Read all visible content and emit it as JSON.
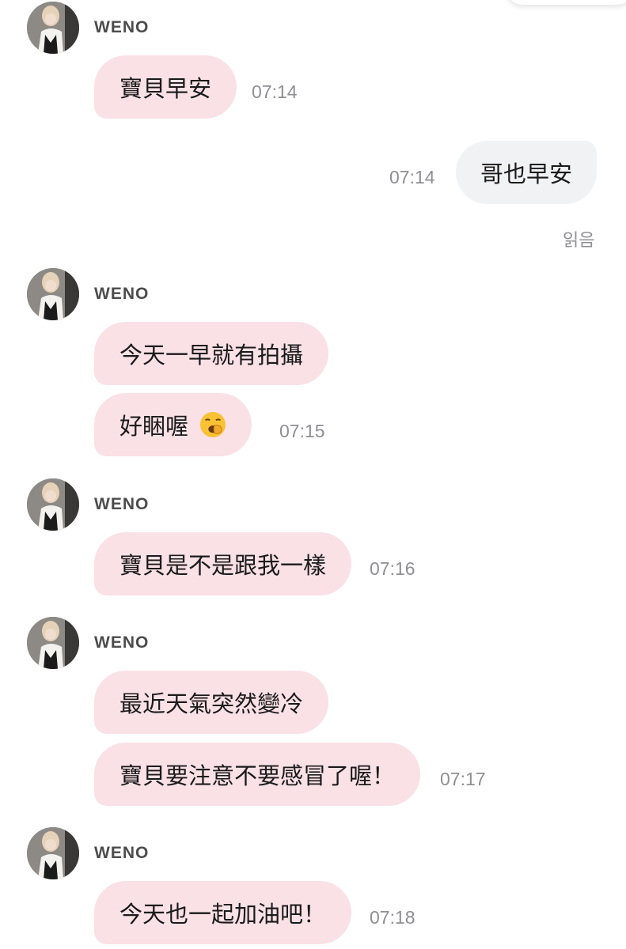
{
  "status": {
    "read_label": "읽음"
  },
  "messages": [
    {
      "sender": "WENO",
      "avatar": "avatar-icon",
      "bubbles": [
        {
          "text": "寶貝早安",
          "time": "07:14"
        }
      ]
    },
    {
      "outgoing": true,
      "text": "哥也早安",
      "time": "07:14"
    },
    {
      "sender": "WENO",
      "avatar": "avatar-icon",
      "bubbles": [
        {
          "text": "今天一早就有拍攝",
          "time": ""
        },
        {
          "text": "好睏喔",
          "emoji": "yawning-face-icon",
          "time": "07:15"
        }
      ]
    },
    {
      "sender": "WENO",
      "avatar": "avatar-icon",
      "bubbles": [
        {
          "text": "寶貝是不是跟我一樣",
          "time": "07:16"
        }
      ]
    },
    {
      "sender": "WENO",
      "avatar": "avatar-icon",
      "bubbles": [
        {
          "text": "最近天氣突然變冷",
          "time": ""
        },
        {
          "text": "寶貝要注意不要感冒了喔！",
          "time": "07:17"
        }
      ]
    },
    {
      "sender": "WENO",
      "avatar": "avatar-icon",
      "bubbles": [
        {
          "text": "今天也一起加油吧！",
          "time": "07:18"
        }
      ]
    }
  ],
  "colors": {
    "incoming_bubble": "#f9e1e6",
    "outgoing_bubble": "#f1f2f4",
    "timestamp": "#8e8e93"
  }
}
